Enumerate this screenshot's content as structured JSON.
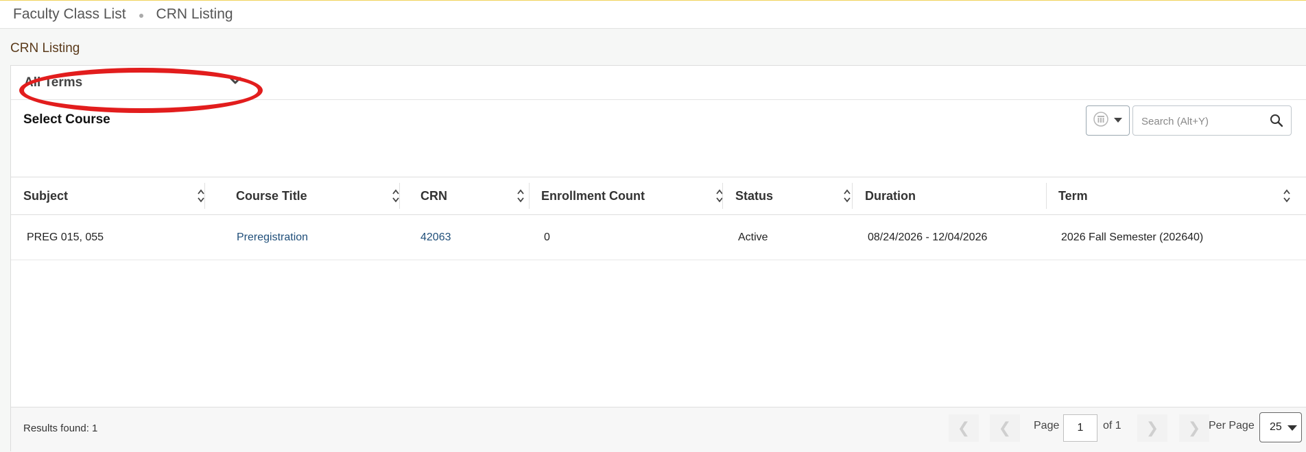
{
  "breadcrumb": {
    "items": [
      "Faculty Class List",
      "CRN Listing"
    ]
  },
  "section_title": "CRN Listing",
  "terms_filter": {
    "selected": "All Terms"
  },
  "select_course_label": "Select Course",
  "search": {
    "placeholder": "Search (Alt+Y)",
    "value": ""
  },
  "table": {
    "columns": [
      "Subject",
      "Course Title",
      "CRN",
      "Enrollment Count",
      "Status",
      "Duration",
      "Term"
    ],
    "rows": [
      {
        "subject": "PREG 015, 055",
        "course_title": "Preregistration",
        "crn": "42063",
        "enrollment_count": "0",
        "status": "Active",
        "duration": "08/24/2026 - 12/04/2026",
        "term": "2026 Fall Semester (202640)"
      }
    ]
  },
  "footer": {
    "results": "Results found: 1",
    "page_label": "Page",
    "page_value": "1",
    "of_label": "of 1",
    "per_page_label": "Per Page",
    "per_page_value": "25"
  },
  "colors": {
    "highlight": "#e21d1d",
    "link": "#1f4e79",
    "top_accent": "#f0d25a",
    "section_title": "#5a3a1a"
  }
}
